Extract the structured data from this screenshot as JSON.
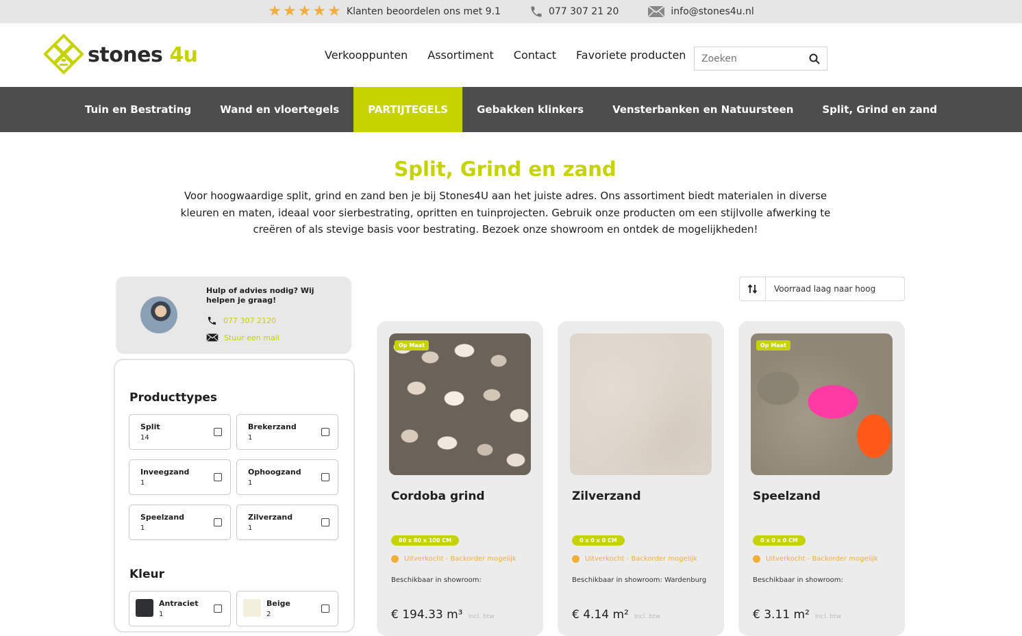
{
  "topbar": {
    "rating_text": "Klanten beoordelen ons met 9.1",
    "phone": "077 307 21 20",
    "email": "info@stones4u.nl",
    "star_color": "#f3ad3d"
  },
  "header": {
    "logo_main": "stones ",
    "logo_accent": "4u",
    "nav": [
      "Verkooppunten",
      "Assortiment",
      "Contact",
      "Favoriete producten"
    ],
    "search_placeholder": "Zoeken"
  },
  "categories": [
    {
      "label": "Tuin en Bestrating",
      "active": false
    },
    {
      "label": "Wand en vloertegels",
      "active": false
    },
    {
      "label": "PARTIJTEGELS",
      "active": true
    },
    {
      "label": "Gebakken klinkers",
      "active": false
    },
    {
      "label": "Vensterbanken en Natuursteen",
      "active": false
    },
    {
      "label": "Split, Grind en zand",
      "active": false
    }
  ],
  "page": {
    "title": "Split, Grind en zand",
    "intro": "Voor hoogwaardige split, grind en zand ben je bij Stones4U aan het juiste adres. Ons assortiment biedt materialen in diverse kleuren en maten, ideaal voor sierbestrating, opritten en tuinprojecten. Gebruik onze producten om een stijlvolle afwerking te creëren of als stevige basis voor bestrating. Bezoek onze showroom en ontdek de mogelijkheden!"
  },
  "help": {
    "title": "Hulp of advies nodig? Wij helpen je graag!",
    "phone": "077 307 2120",
    "mail_label": "Stuur een mail"
  },
  "filters": {
    "producttypes_title": "Producttypes",
    "producttypes": [
      {
        "label": "Split",
        "count": "14"
      },
      {
        "label": "Brekerzand",
        "count": "1"
      },
      {
        "label": "Inveegzand",
        "count": "1"
      },
      {
        "label": "Ophoogzand",
        "count": "1"
      },
      {
        "label": "Speelzand",
        "count": "1"
      },
      {
        "label": "Zilverzand",
        "count": "1"
      }
    ],
    "kleur_title": "Kleur",
    "kleur": [
      {
        "label": "Antraciet",
        "count": "1",
        "color": "#2e3033"
      },
      {
        "label": "Beige",
        "count": "2",
        "color": "#f2efdc"
      }
    ]
  },
  "sort": {
    "value": "Voorraad laag naar hoog"
  },
  "products": [
    {
      "name": "Cordoba grind",
      "badge": "Op Maat",
      "size": "80 x 80 x 100 CM",
      "stock": "Uitverkocht - Backorder mogelijk",
      "showroom_label": "Beschikbaar in showroom:",
      "showroom_value": "",
      "price": "€ 194.33 m³",
      "btw": "Incl. btw"
    },
    {
      "name": "Zilverzand",
      "badge": "",
      "size": "0 x 0 x 0 CM",
      "stock": "Uitverkocht - Backorder mogelijk",
      "showroom_label": "Beschikbaar in showroom:",
      "showroom_value": "Wardenburg",
      "price": "€ 4.14 m²",
      "btw": "Incl. btw"
    },
    {
      "name": "Speelzand",
      "badge": "Op Maat",
      "size": "0 x 0 x 0 CM",
      "stock": "Uitverkocht - Backorder mogelijk",
      "showroom_label": "Beschikbaar in showroom:",
      "showroom_value": "",
      "price": "€ 3.11 m²",
      "btw": "Incl. btw"
    }
  ],
  "colors": {
    "accent": "#c5d301",
    "catbar": "#4d4d4d",
    "stock": "#f3ad3d"
  }
}
